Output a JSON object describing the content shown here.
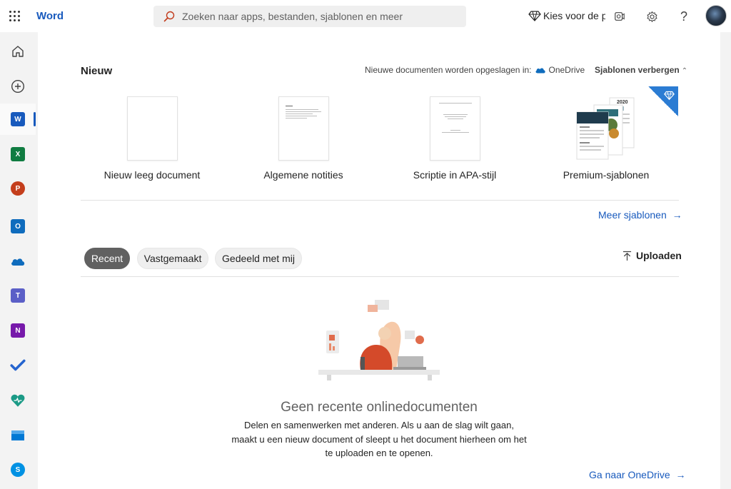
{
  "app": {
    "name": "Word"
  },
  "search": {
    "placeholder": "Zoeken naar apps, bestanden, sjablonen en meer"
  },
  "topbar": {
    "premium_label": "Kies voor de premium",
    "icons": [
      "waffle-icon",
      "diamond-icon",
      "camera-icon",
      "gear-icon",
      "help-icon",
      "avatar"
    ]
  },
  "rail": {
    "items": [
      {
        "name": "home",
        "icon": "home-icon"
      },
      {
        "name": "create",
        "icon": "plus-circle-icon"
      },
      {
        "name": "word",
        "icon": "word-icon",
        "active": true
      },
      {
        "name": "excel",
        "icon": "excel-icon"
      },
      {
        "name": "powerpoint",
        "icon": "powerpoint-icon"
      },
      {
        "name": "outlook",
        "icon": "outlook-icon"
      },
      {
        "name": "onedrive",
        "icon": "onedrive-icon"
      },
      {
        "name": "teams",
        "icon": "teams-icon"
      },
      {
        "name": "onenote",
        "icon": "onenote-icon"
      },
      {
        "name": "todo",
        "icon": "todo-icon"
      },
      {
        "name": "family-safety",
        "icon": "heart-icon"
      },
      {
        "name": "store",
        "icon": "store-icon"
      },
      {
        "name": "skype",
        "icon": "skype-icon"
      }
    ]
  },
  "new_section": {
    "title": "Nieuw",
    "save_note": "Nieuwe documenten worden opgeslagen in:",
    "save_location": "OneDrive",
    "hide_templates": "Sjablonen verbergen",
    "templates": [
      {
        "label": "Nieuw leeg document"
      },
      {
        "label": "Algemene notities"
      },
      {
        "label": "Scriptie in APA-stijl"
      },
      {
        "label": "Premium-sjablonen",
        "year": "2020"
      }
    ],
    "more_templates": "Meer sjablonen"
  },
  "recent_section": {
    "tabs": [
      {
        "label": "Recent",
        "active": true
      },
      {
        "label": "Vastgemaakt",
        "active": false
      },
      {
        "label": "Gedeeld met mij",
        "active": false
      }
    ],
    "upload_label": "Uploaden",
    "empty_title": "Geen recente onlinedocumenten",
    "empty_desc": "Delen en samenwerken met anderen. Als u aan de slag wilt gaan, maakt u een nieuw document of sleept u het document hierheen om het te uploaden en te openen.",
    "go_onedrive": "Ga naar OneDrive"
  },
  "colors": {
    "accent": "#185abd",
    "active_pill": "#616161",
    "page_bg": "#f3f3f3",
    "panel_bg": "#ffffff",
    "premium_corner": "#2b7cd3"
  }
}
